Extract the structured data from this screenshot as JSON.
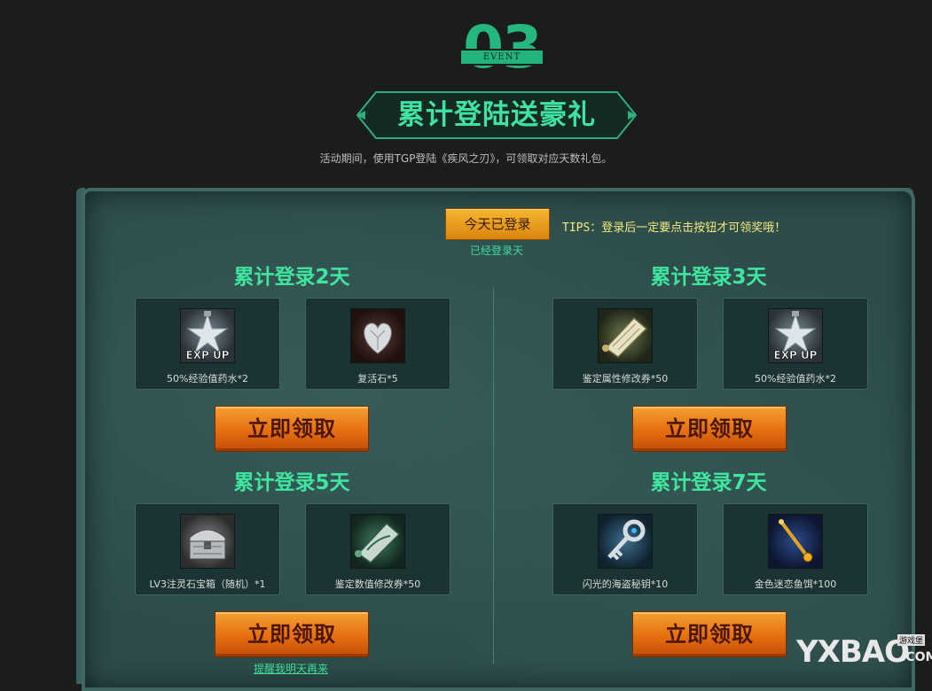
{
  "header": {
    "badge_number": "03",
    "badge_tag": "EVENT",
    "title": "累计登陆送豪礼",
    "subtitle": "活动期间，使用TGP登陆《疾风之刃》，可领取对应天数礼包。"
  },
  "login": {
    "button_label": "今天已登录",
    "days_text": "已经登录天",
    "tips": "TIPS：登录后一定要点击按钮才可领奖哦！"
  },
  "sections": [
    {
      "title": "累计登录2天",
      "items": [
        {
          "label": "50%经验值药水*2",
          "icon": "exp-potion-icon",
          "icon_text": "EXP UP"
        },
        {
          "label": "复活石*5",
          "icon": "revive-stone-icon"
        }
      ],
      "claim_label": "立即领取"
    },
    {
      "title": "累计登录3天",
      "items": [
        {
          "label": "鉴定属性修改券*50",
          "icon": "scroll-icon"
        },
        {
          "label": "50%经验值药水*2",
          "icon": "exp-potion-icon",
          "icon_text": "EXP UP"
        }
      ],
      "claim_label": "立即领取"
    },
    {
      "title": "累计登录5天",
      "items": [
        {
          "label": "LV3注灵石宝箱（随机）*1",
          "icon": "treasure-chest-icon"
        },
        {
          "label": "鉴定数值修改券*50",
          "icon": "green-scroll-icon"
        }
      ],
      "claim_label": "立即领取"
    },
    {
      "title": "累计登录7天",
      "items": [
        {
          "label": "闪光的海盗秘钥*10",
          "icon": "key-icon"
        },
        {
          "label": "金色迷恋鱼饵*100",
          "icon": "golden-bait-icon"
        }
      ],
      "claim_label": "立即领取"
    }
  ],
  "remind_link": "提醒我明天再来",
  "watermark": {
    "text": "YXBAO",
    "small": "游戏堡",
    "com": ".COM"
  },
  "colors": {
    "background": "#1b1c1c",
    "accent_green": "#3fe69f",
    "panel": "#2d4c4a",
    "claim_orange": "#e66e10",
    "tips_yellow": "#f3ea7f"
  }
}
